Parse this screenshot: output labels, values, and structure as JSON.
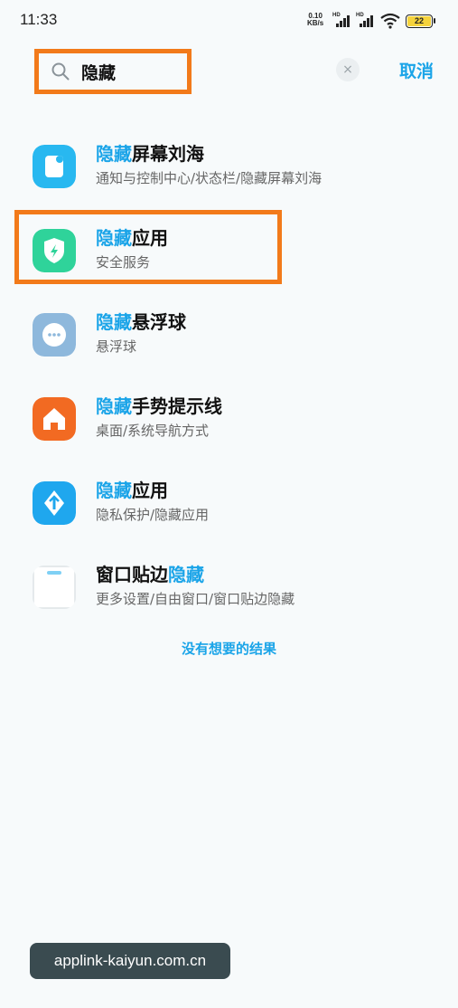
{
  "status_bar": {
    "time": "11:33",
    "net_speed_value": "0.10",
    "net_speed_unit": "KB/s",
    "signal_labels": [
      "HD",
      "HD"
    ],
    "battery": "22"
  },
  "search": {
    "query": "隐藏",
    "clear_label": "×",
    "cancel_label": "取消"
  },
  "results": [
    {
      "highlight": "隐藏",
      "rest": "屏幕刘海",
      "subtitle": "通知与控制中心/状态栏/隐藏屏幕刘海",
      "icon": "notch-settings-icon",
      "icon_color": "#28b8f0"
    },
    {
      "highlight": "隐藏",
      "rest": "应用",
      "subtitle": "安全服务",
      "icon": "security-shield-icon",
      "icon_color": "#2fd39a"
    },
    {
      "highlight": "隐藏",
      "rest": "悬浮球",
      "subtitle": "悬浮球",
      "icon": "floating-ball-icon",
      "icon_color": "#8eb8dc"
    },
    {
      "highlight": "隐藏",
      "rest": "手势提示线",
      "subtitle": "桌面/系统导航方式",
      "icon": "home-icon",
      "icon_color": "#f26a22"
    },
    {
      "highlight": "隐藏",
      "rest": "应用",
      "subtitle": "隐私保护/隐藏应用",
      "icon": "privacy-protection-icon",
      "icon_color": "#1fa7ee"
    },
    {
      "prefix": "窗口贴边",
      "highlight": "隐藏",
      "subtitle": "更多设置/自由窗口/窗口贴边隐藏",
      "icon": "window-edge-icon",
      "icon_color": "#ffffff"
    }
  ],
  "no_result_link": "没有想要的结果",
  "watermark": "applink-kaiyun.com.cn",
  "colors": {
    "accent": "#1aa4e8",
    "annotation_box": "#f27a1a"
  }
}
